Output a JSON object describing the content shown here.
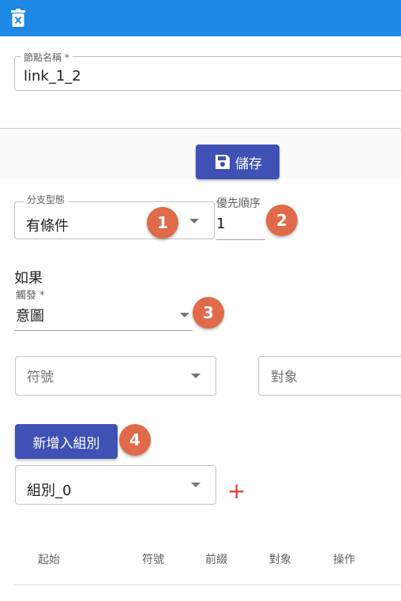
{
  "toolbar": {
    "delete_icon": "trash-icon",
    "accent": "#1e88e5"
  },
  "node_name": {
    "label": "節點名稱 *",
    "value": "link_1_2"
  },
  "save_button": {
    "label": "儲存",
    "icon": "floppy-disk-icon"
  },
  "branch_type": {
    "label": "分支型態",
    "value": "有條件",
    "badge": "1"
  },
  "priority": {
    "label": "優先順序",
    "value": "1",
    "badge": "2"
  },
  "condition": {
    "title": "如果",
    "trigger_label": "觸發 *",
    "trigger_value": "意圖",
    "trigger_badge": "3",
    "symbol_placeholder": "符號",
    "target_placeholder": "對象"
  },
  "group": {
    "add_label": "新增入組別",
    "add_badge": "4",
    "selected": "組別_0",
    "add_icon": "plus-icon"
  },
  "table": {
    "columns": [
      "起始",
      "符號",
      "前綴",
      "對象",
      "操作"
    ]
  },
  "colors": {
    "primary": "#3f51b5",
    "badge": "#e06a4a",
    "plus": "#e53935"
  }
}
